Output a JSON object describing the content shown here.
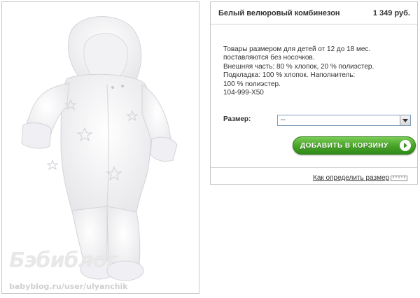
{
  "product": {
    "title": "Белый велюровый комбинезон",
    "price": "1 349 руб.",
    "description_lines": [
      "Товары размером для детей от 12 до 18 мес.",
      "поставляются без носочков.",
      "Внешняя часть: 80 % хлопок, 20 % полиэстер.",
      "Подкладка: 100 % хлопок. Наполнитель:",
      "100 % полиэстер.",
      "104-999-X50"
    ],
    "size_label": "Размер:",
    "size_selected": "--",
    "add_to_cart_label": "ДОБАВИТЬ В КОРЗИНУ",
    "size_help_link": "Как определить размер"
  },
  "photo": {
    "watermark_logo": "Бэбиблог",
    "watermark_url": "babyblog.ru/user/ulyanchik"
  },
  "colors": {
    "button_green": "#4aa52a",
    "border": "#c8c8c8",
    "text": "#333333"
  },
  "icons": {
    "select_arrow": "chevron-down-icon",
    "button_arrow": "arrow-right-circle-icon",
    "help": "ruler-icon"
  }
}
